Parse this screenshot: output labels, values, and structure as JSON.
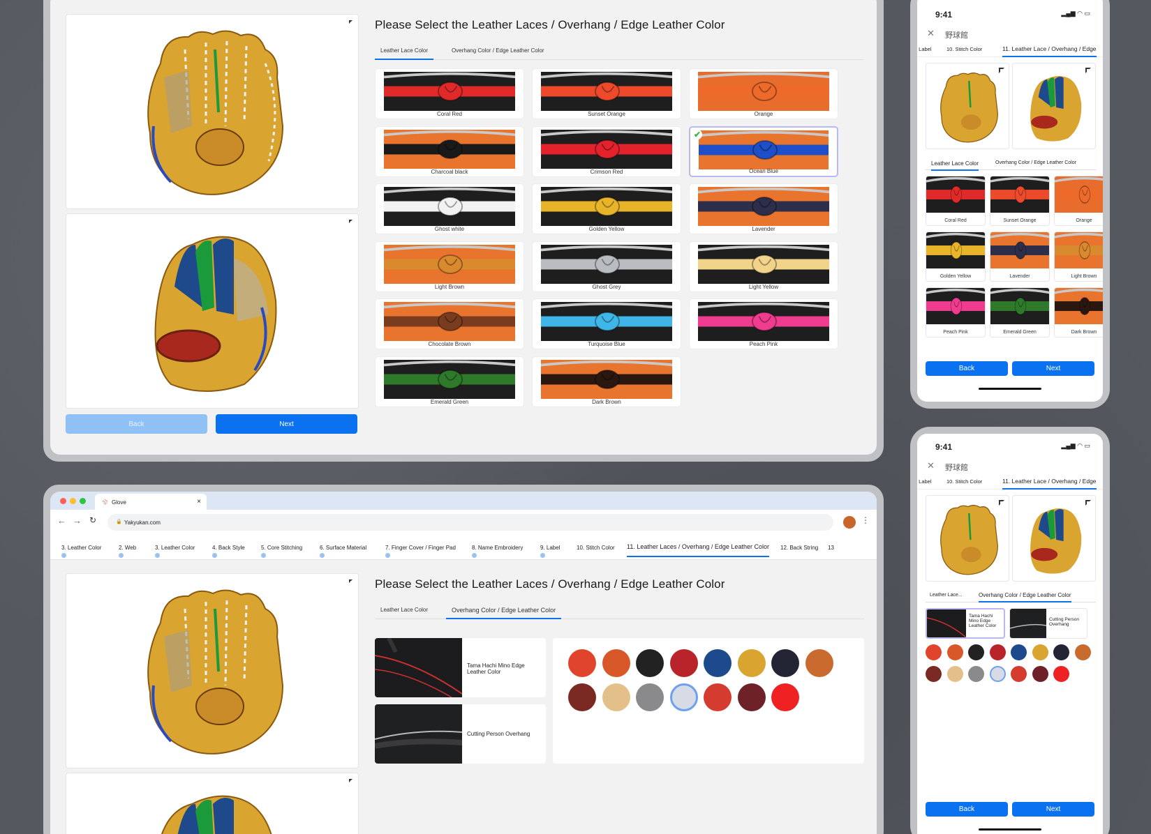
{
  "desktop": {
    "title": "Please Select the Leather Laces / Overhang / Edge Leather Color",
    "tabs": [
      "Leather Lace Color",
      "Overhang Color / Edge Leather Color"
    ],
    "back_label": "Back",
    "next_label": "Next",
    "laces": [
      {
        "name": "Coral Red",
        "bg": "#1e1e1e",
        "knot": "#e02a2a"
      },
      {
        "name": "Sunset Orange",
        "bg": "#1e1e1e",
        "knot": "#ec4a2b"
      },
      {
        "name": "Orange",
        "bg": "#e86c2c",
        "knot": "#ee6a2a"
      },
      {
        "name": "Charcoal black",
        "bg": "#e8742e",
        "knot": "#1a1a1a"
      },
      {
        "name": "Crimson Red",
        "bg": "#1e1e1e",
        "knot": "#e3222c"
      },
      {
        "name": "Ocean Blue",
        "bg": "#e8742e",
        "knot": "#1e4fc8",
        "selected": true
      },
      {
        "name": "Ghost white",
        "bg": "#1e1e1e",
        "knot": "#f2f2f2"
      },
      {
        "name": "Golden Yellow",
        "bg": "#1e1e1e",
        "knot": "#e8b52a"
      },
      {
        "name": "Lavender",
        "bg": "#e8742e",
        "knot": "#2d2f4a"
      },
      {
        "name": "Light Brown",
        "bg": "#e8742e",
        "knot": "#d9892e"
      },
      {
        "name": "Ghost Grey",
        "bg": "#1e1e1e",
        "knot": "#b9bcc0"
      },
      {
        "name": "Light Yellow",
        "bg": "#1e1e1e",
        "knot": "#f2d38a"
      },
      {
        "name": "Chocolate Brown",
        "bg": "#e8742e",
        "knot": "#7a3c1e"
      },
      {
        "name": "Turquoise Blue",
        "bg": "#1e1e1e",
        "knot": "#3fb5e8"
      },
      {
        "name": "Peach Pink",
        "bg": "#1e1e1e",
        "knot": "#ef3c8e"
      },
      {
        "name": "Emerald Green",
        "bg": "#1e1e1e",
        "knot": "#2f7a2a"
      },
      {
        "name": "Dark Brown",
        "bg": "#e8742e",
        "knot": "#2a1810"
      }
    ]
  },
  "browser": {
    "tab_title": "Glove",
    "url": "Yakyukan.com",
    "steps": [
      "3. Leather Color",
      "2. Web",
      "3. Leather Color",
      "4. Back Style",
      "5. Core Stitching",
      "6. Surface Material",
      "7. Finger Cover / Finger Pad",
      "8. Name Embroidery",
      "9. Label",
      "10. Stitch Color",
      "11. Leather Laces / Overhang / Edge Leather Color",
      "12. Back String",
      "13"
    ],
    "title": "Please Select the Leather Laces / Overhang / Edge Leather Color",
    "tabs": [
      "Leather Lace Color",
      "Overhang Color / Edge Leather Color"
    ],
    "options": [
      "Tama Hachi Mino Edge Leather Color",
      "Cutting Person Overhang"
    ],
    "swatches": [
      "#e0442c",
      "#d9582a",
      "#222222",
      "#b8242a",
      "#1d4a8c",
      "#d9a430",
      "#232535",
      "#c96a2e",
      "#7a2a22",
      "#e3c08a",
      "#8a8a8c",
      "#d7dbe6",
      "#d63b30",
      "#6e2228",
      "#ee2222"
    ]
  },
  "mobile": {
    "time": "9:41",
    "logo": "野球館",
    "steps": [
      ". Label",
      "10. Stitch Color",
      "11. Leather Lace / Overhang / Edge"
    ],
    "tabs": [
      "Leather Lace Color",
      "Overhang Color / Edge Leather Color"
    ],
    "tabs2": [
      "Leather Lace...",
      "Overhang Color / Edge Leather Color"
    ],
    "back_label": "Back",
    "next_label": "Next",
    "laces": [
      {
        "name": "Coral Red",
        "bg": "#1e1e1e",
        "knot": "#e02a2a"
      },
      {
        "name": "Sunset Orange",
        "bg": "#1e1e1e",
        "knot": "#ec4a2b"
      },
      {
        "name": "Orange",
        "bg": "#e86c2c",
        "knot": "#ee6a2a"
      },
      {
        "name": "Golden Yellow",
        "bg": "#1e1e1e",
        "knot": "#e8b52a"
      },
      {
        "name": "Lavender",
        "bg": "#e8742e",
        "knot": "#2d2f4a"
      },
      {
        "name": "Light Brown",
        "bg": "#e8742e",
        "knot": "#d9892e"
      },
      {
        "name": "Peach Pink",
        "bg": "#1e1e1e",
        "knot": "#ef3c8e"
      },
      {
        "name": "Emerald Green",
        "bg": "#1e1e1e",
        "knot": "#2f7a2a"
      },
      {
        "name": "Dark Brown",
        "bg": "#e8742e",
        "knot": "#2a1810"
      }
    ],
    "options": [
      "Tama Hachi Mino Edge Leather Color",
      "Cutting Person Overhang"
    ],
    "swatches": [
      "#e0442c",
      "#d9582a",
      "#222222",
      "#b8242a",
      "#1d4a8c",
      "#d9a430",
      "#232535",
      "#c96a2e",
      "#7a2a22",
      "#e3c08a",
      "#8a8a8c",
      "#d7dbe6",
      "#d63b30",
      "#6e2228",
      "#ee2222"
    ]
  }
}
